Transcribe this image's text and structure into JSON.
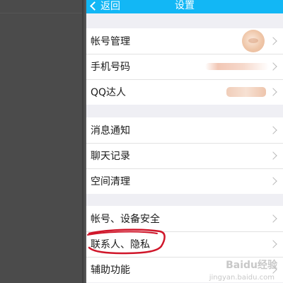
{
  "navbar": {
    "back_label": "返回",
    "title": "设置",
    "background": "#12b7f5"
  },
  "groups": [
    {
      "rows": [
        {
          "label": "帐号管理",
          "accessory": "avatar",
          "icon": "chevron-right-icon"
        },
        {
          "label": "手机号码",
          "accessory": "blurred-phone-number",
          "icon": "chevron-right-icon"
        },
        {
          "label": "QQ达人",
          "accessory": "blurred-badge",
          "icon": "chevron-right-icon"
        }
      ]
    },
    {
      "rows": [
        {
          "label": "消息通知",
          "icon": "chevron-right-icon"
        },
        {
          "label": "聊天记录",
          "icon": "chevron-right-icon"
        },
        {
          "label": "空间清理",
          "icon": "chevron-right-icon"
        }
      ]
    },
    {
      "rows": [
        {
          "label": "帐号、设备安全",
          "icon": "chevron-right-icon"
        },
        {
          "label": "联系人、隐私",
          "icon": "chevron-right-icon",
          "highlighted": true,
          "highlight_color": "#d0162a"
        },
        {
          "label": "辅助功能",
          "icon": "chevron-right-icon"
        }
      ]
    }
  ],
  "watermark": {
    "text": "Baidu经验",
    "subtext": "jingyan.baidu.com"
  }
}
